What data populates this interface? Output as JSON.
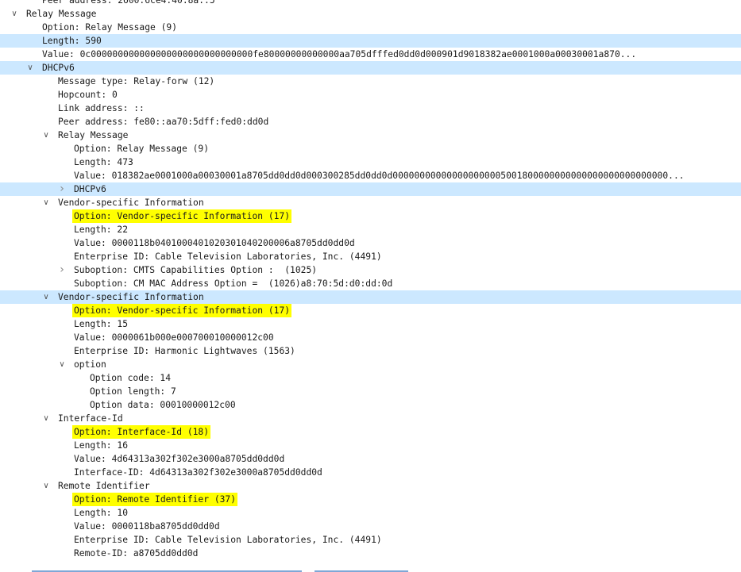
{
  "rows": [
    {
      "text": "Peer address: 2600:6ce4:40:8a::5",
      "level": 1,
      "arrow": "none"
    },
    {
      "text": "Relay Message",
      "level": 0,
      "arrow": "expanded"
    },
    {
      "text": "Option: Relay Message (9)",
      "level": 1,
      "arrow": "none"
    },
    {
      "text": "Length: 590",
      "level": 1,
      "arrow": "none",
      "selected": true
    },
    {
      "text": "Value: 0c000000000000000000000000000000fe80000000000000aa705dfffed0dd0d000901d9018382ae0001000a00030001a870...",
      "level": 1,
      "arrow": "none"
    },
    {
      "text": "DHCPv6",
      "level": 1,
      "arrow": "expanded",
      "selected": true
    },
    {
      "text": "Message type: Relay-forw (12)",
      "level": 2,
      "arrow": "none"
    },
    {
      "text": "Hopcount: 0",
      "level": 2,
      "arrow": "none"
    },
    {
      "text": "Link address: ::",
      "level": 2,
      "arrow": "none"
    },
    {
      "text": "Peer address: fe80::aa70:5dff:fed0:dd0d",
      "level": 2,
      "arrow": "none"
    },
    {
      "text": "Relay Message",
      "level": 2,
      "arrow": "expanded"
    },
    {
      "text": "Option: Relay Message (9)",
      "level": 3,
      "arrow": "none"
    },
    {
      "text": "Length: 473",
      "level": 3,
      "arrow": "none"
    },
    {
      "text": "Value: 018382ae0001000a00030001a8705dd0dd0d000300285dd0dd0d000000000000000000005001800000000000000000000000000...",
      "level": 3,
      "arrow": "none"
    },
    {
      "text": "DHCPv6",
      "level": 3,
      "arrow": "collapsed",
      "selected": true
    },
    {
      "text": "Vendor-specific Information",
      "level": 2,
      "arrow": "expanded"
    },
    {
      "text": "Option: Vendor-specific Information (17)",
      "level": 3,
      "arrow": "none",
      "highlight": true
    },
    {
      "text": "Length: 22",
      "level": 3,
      "arrow": "none"
    },
    {
      "text": "Value: 0000118b0401000401020301040200006a8705dd0dd0d",
      "level": 3,
      "arrow": "none"
    },
    {
      "text": "Enterprise ID: Cable Television Laboratories, Inc. (4491)",
      "level": 3,
      "arrow": "none"
    },
    {
      "text": "Suboption: CMTS Capabilities Option :  (1025)",
      "level": 3,
      "arrow": "collapsed"
    },
    {
      "text": "Suboption: CM MAC Address Option =  (1026)a8:70:5d:d0:dd:0d",
      "level": 3,
      "arrow": "none"
    },
    {
      "text": "Vendor-specific Information",
      "level": 2,
      "arrow": "expanded",
      "selected": true
    },
    {
      "text": "Option: Vendor-specific Information (17)",
      "level": 3,
      "arrow": "none",
      "highlight": true
    },
    {
      "text": "Length: 15",
      "level": 3,
      "arrow": "none"
    },
    {
      "text": "Value: 0000061b000e000700010000012c00",
      "level": 3,
      "arrow": "none"
    },
    {
      "text": "Enterprise ID: Harmonic Lightwaves (1563)",
      "level": 3,
      "arrow": "none"
    },
    {
      "text": "option",
      "level": 3,
      "arrow": "expanded"
    },
    {
      "text": "Option code: 14",
      "level": 4,
      "arrow": "none"
    },
    {
      "text": "Option length: 7",
      "level": 4,
      "arrow": "none"
    },
    {
      "text": "Option data: 00010000012c00",
      "level": 4,
      "arrow": "none"
    },
    {
      "text": "Interface-Id",
      "level": 2,
      "arrow": "expanded"
    },
    {
      "text": "Option: Interface-Id (18)",
      "level": 3,
      "arrow": "none",
      "highlight": true
    },
    {
      "text": "Length: 16",
      "level": 3,
      "arrow": "none"
    },
    {
      "text": "Value: 4d64313a302f302e3000a8705dd0dd0d",
      "level": 3,
      "arrow": "none"
    },
    {
      "text": "Interface-ID: 4d64313a302f302e3000a8705dd0dd0d",
      "level": 3,
      "arrow": "none"
    },
    {
      "text": "Remote Identifier",
      "level": 2,
      "arrow": "expanded"
    },
    {
      "text": "Option: Remote Identifier (37)",
      "level": 3,
      "arrow": "none",
      "highlight": true
    },
    {
      "text": "Length: 10",
      "level": 3,
      "arrow": "none"
    },
    {
      "text": "Value: 0000118ba8705dd0dd0d",
      "level": 3,
      "arrow": "none"
    },
    {
      "text": "Enterprise ID: Cable Television Laboratories, Inc. (4491)",
      "level": 3,
      "arrow": "none"
    },
    {
      "text": "Remote-ID: a8705dd0dd0d",
      "level": 3,
      "arrow": "none"
    }
  ],
  "icons": {
    "expanded": "chevron-down-icon",
    "collapsed": "chevron-right-icon"
  },
  "colors": {
    "selection": "#cce8ff",
    "highlight": "#ffff00"
  }
}
